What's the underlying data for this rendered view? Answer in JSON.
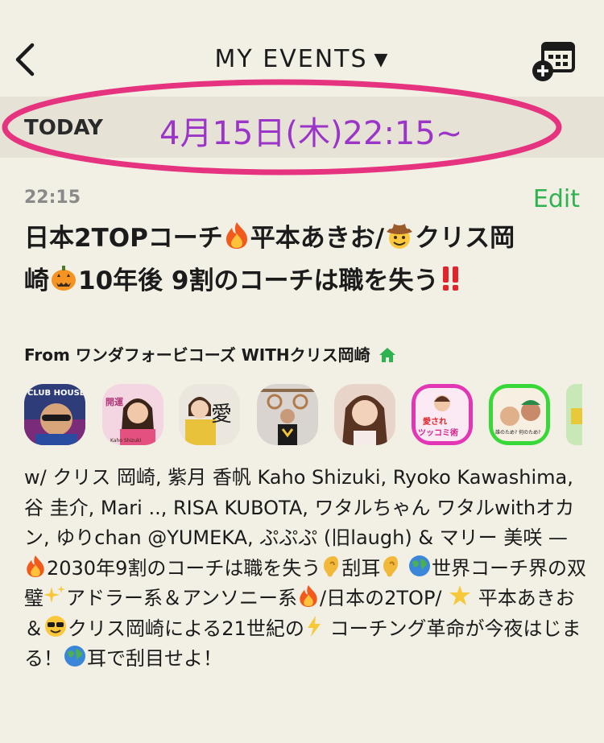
{
  "header": {
    "title": "MY EVENTS",
    "caret": "▼",
    "back_icon": "chevron-left-icon",
    "calendar_icon": "calendar-add-icon"
  },
  "today": {
    "label": "TODAY",
    "datetime": "4月15日(木)22:15~"
  },
  "event": {
    "time": "22:15",
    "edit_label": "Edit",
    "title_parts": [
      "日本2TOPコーチ",
      "平本あきお/",
      "クリス岡崎",
      "10年後 9割のコーチは職を失う",
      ""
    ],
    "from": "From ワンダフォービコーズ WITHクリス岡崎",
    "avatar_labels": [
      "CLUB HOUSE",
      "開運",
      "Kaho Shizuki",
      "愛",
      "愛され",
      "ツッコミ術",
      "誰のため? 何のため?"
    ],
    "description_parts": [
      "w/ クリス 岡崎, 紫月 香帆 Kaho Shizuki, Ryoko Kawashima, 谷 圭介, Mari .., RISA KUBOTA, ワタルちゃん ワタルwithオカン, ゆりchan @YUMEKA, ぷぷぷ (旧laugh) & マリー 美咲 — ",
      "2030年9割のコーチは職を失う",
      "刮耳",
      "",
      "世界コーチ界の双璧",
      "アドラー系＆アンソニー系",
      "/日本の2TOP/ ",
      "平本あきお＆",
      "クリス岡崎による21世紀の",
      "コーチング革命が今夜はじまる！",
      "耳で刮目せよ！"
    ]
  },
  "colors": {
    "background": "#f2efe4",
    "band": "#e6e2d6",
    "accent_green": "#2fb24f",
    "datetime_purple": "#9a35c8",
    "ring_pink": "#e6337f"
  }
}
